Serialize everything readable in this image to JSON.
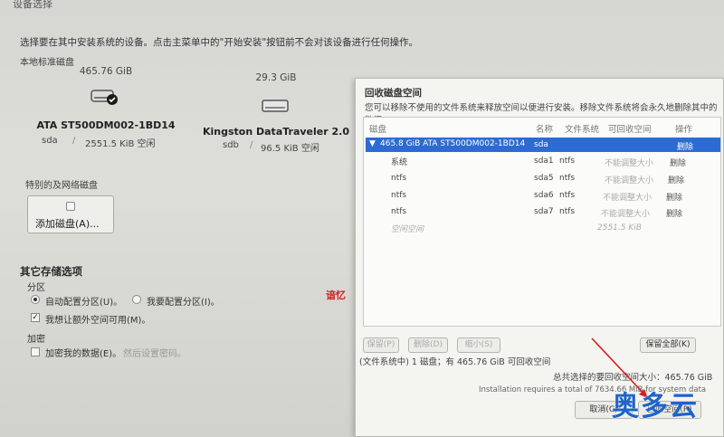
{
  "header": {
    "title": "设备选择",
    "instruction": "选择要在其中安装系统的设备。点击主菜单中的\"开始安装\"按钮前不会对该设备进行任何操作。"
  },
  "local_disks": {
    "label": "本地标准磁盘",
    "disks": [
      {
        "size": "465.76 GiB",
        "name": "ATA ST500DM002-1BD14",
        "device": "sda",
        "free": "2551.5 KiB 空闲",
        "icon": "hard-disk-icon",
        "selected": true
      },
      {
        "size": "29.3 GiB",
        "name": "Kingston DataTraveler 2.0",
        "device": "sdb",
        "free": "96.5 KiB 空闲",
        "icon": "usb-drive-icon",
        "selected": false
      }
    ]
  },
  "special_disks": {
    "label": "特别的及网络磁盘",
    "add_button": "添加磁盘(A)..."
  },
  "other_options": {
    "heading": "其它存储选项",
    "partition_label": "分区",
    "auto_partition": "自动配置分区(U)。",
    "manual_partition": "我要配置分区(I)。",
    "extra_space": "我想让额外空间可用(M)。",
    "encryption_label": "加密",
    "encrypt_data": "加密我的数据(E)。",
    "encrypt_hint": "然后设置密码。"
  },
  "watermark_text": "谙忆",
  "dialog": {
    "title": "回收磁盘空间",
    "description": "您可以移除不使用的文件系统来释放空间以便进行安装。移除文件系统将会永久地删除其中的数据。",
    "columns": [
      "磁盘",
      "名称",
      "文件系统",
      "可回收空间",
      "操作"
    ],
    "selected_row": {
      "disk": "465.8 GiB ATA ST500DM002-1BD14",
      "name": "sda",
      "action": "删除"
    },
    "rows": [
      {
        "disk": "系统",
        "name": "sda1",
        "fs": "ntfs",
        "reclaim": "不能调整大小",
        "action": "删除"
      },
      {
        "disk": "ntfs",
        "name": "sda5",
        "fs": "ntfs",
        "reclaim": "不能调整大小",
        "action": "删除"
      },
      {
        "disk": "ntfs",
        "name": "sda6",
        "fs": "ntfs",
        "reclaim": "不能调整大小",
        "action": "删除"
      },
      {
        "disk": "ntfs",
        "name": "sda7",
        "fs": "ntfs",
        "reclaim": "不能调整大小",
        "action": "删除"
      },
      {
        "disk": "空闲空间",
        "name": "",
        "fs": "",
        "reclaim": "2551.5 KiB",
        "action": ""
      }
    ],
    "buttons": {
      "keep": "保留(P)",
      "delete": "删除(D)",
      "shrink": "缩小(S)",
      "keep_all": "保留全部(K)"
    },
    "fs_summary": "(文件系统中) 1 磁盘；有 465.76 GiB 可回收空间",
    "total_selected": "总共选择的要回收空间大小：465.76 GiB",
    "requirement": "Installation requires a total of 7634.66 MiB for system data",
    "cancel": "取消(C)",
    "reclaim": "回收空间(R)"
  },
  "brand_text": "奥多云"
}
